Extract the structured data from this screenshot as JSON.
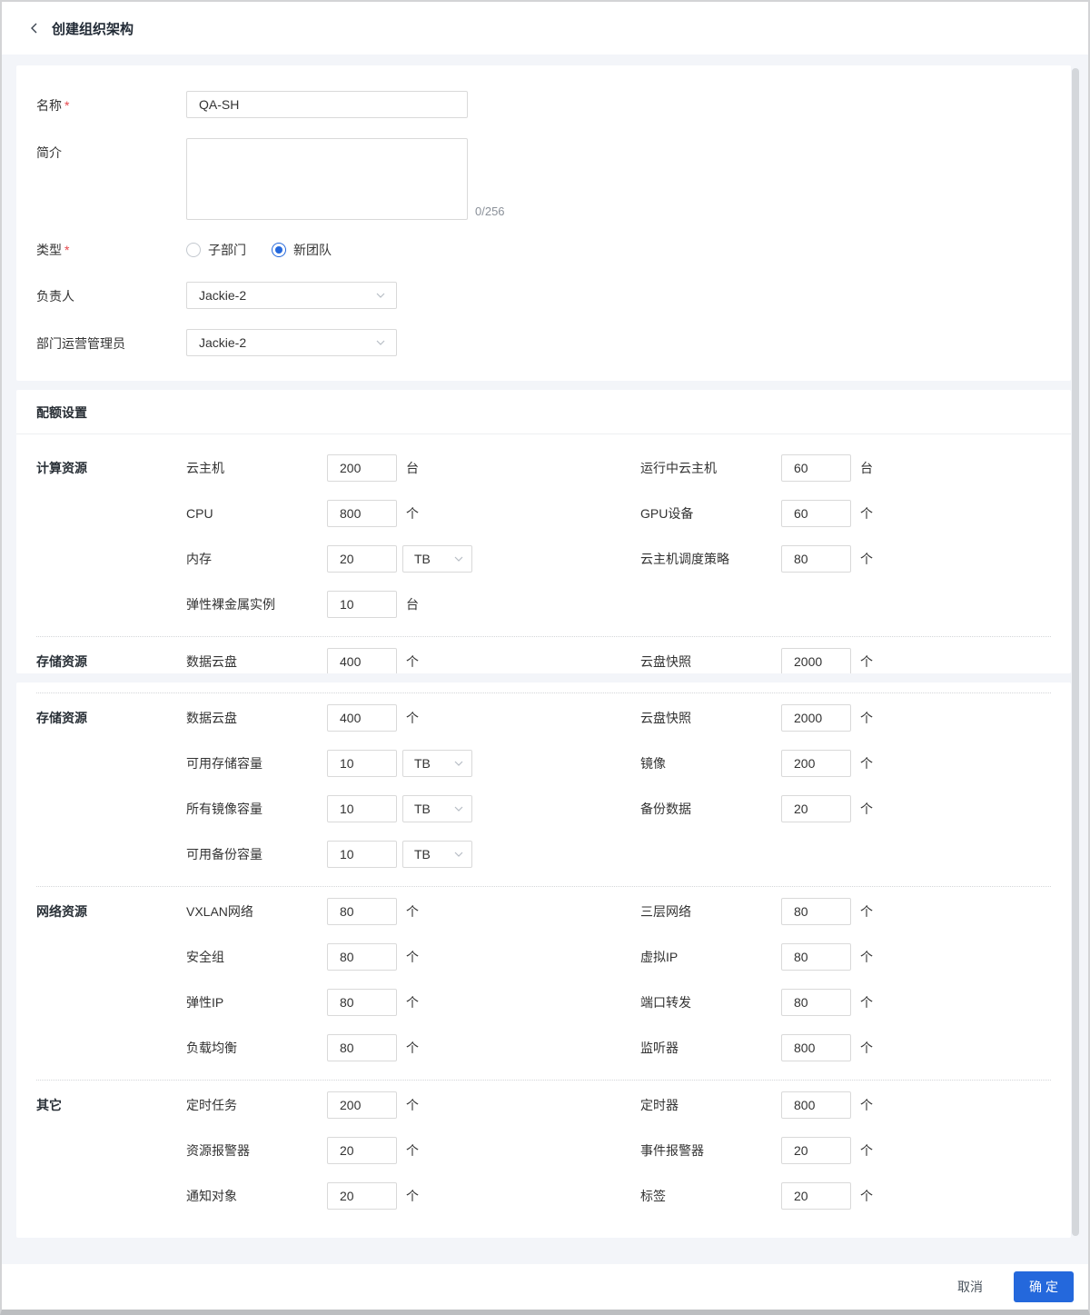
{
  "header": {
    "title": "创建组织架构"
  },
  "marks": {
    "required": "*"
  },
  "basic": {
    "name_label": "名称",
    "name_value": "QA-SH",
    "intro_label": "简介",
    "intro_value": "",
    "intro_counter": "0/256",
    "type_label": "类型",
    "type_options": [
      {
        "label": "子部门",
        "selected": false
      },
      {
        "label": "新团队",
        "selected": true
      }
    ],
    "owner_label": "负责人",
    "owner_value": "Jackie-2",
    "admin_label": "部门运营管理员",
    "admin_value": "Jackie-2"
  },
  "quota": {
    "title": "配额设置",
    "panel1_groups": [
      {
        "category": "计算资源",
        "rows": [
          [
            {
              "label": "云主机",
              "value": "200",
              "unit": "台"
            },
            {
              "label": "运行中云主机",
              "value": "60",
              "unit": "台"
            }
          ],
          [
            {
              "label": "CPU",
              "value": "800",
              "unit": "个"
            },
            {
              "label": "GPU设备",
              "value": "60",
              "unit": "个"
            }
          ],
          [
            {
              "label": "内存",
              "value": "20",
              "unit_select": "TB"
            },
            {
              "label": "云主机调度策略",
              "value": "80",
              "unit": "个"
            }
          ],
          [
            {
              "label": "弹性裸金属实例",
              "value": "10",
              "unit": "台"
            }
          ]
        ]
      },
      {
        "category": "存储资源",
        "rows": [
          [
            {
              "label": "数据云盘",
              "value": "400",
              "unit": "个"
            },
            {
              "label": "云盘快照",
              "value": "2000",
              "unit": "个"
            }
          ]
        ]
      }
    ],
    "panel2_groups": [
      {
        "category": "存储资源",
        "rows": [
          [
            {
              "label": "数据云盘",
              "value": "400",
              "unit": "个"
            },
            {
              "label": "云盘快照",
              "value": "2000",
              "unit": "个"
            }
          ],
          [
            {
              "label": "可用存储容量",
              "value": "10",
              "unit_select": "TB"
            },
            {
              "label": "镜像",
              "value": "200",
              "unit": "个"
            }
          ],
          [
            {
              "label": "所有镜像容量",
              "value": "10",
              "unit_select": "TB"
            },
            {
              "label": "备份数据",
              "value": "20",
              "unit": "个"
            }
          ],
          [
            {
              "label": "可用备份容量",
              "value": "10",
              "unit_select": "TB"
            }
          ]
        ]
      },
      {
        "category": "网络资源",
        "rows": [
          [
            {
              "label": "VXLAN网络",
              "value": "80",
              "unit": "个"
            },
            {
              "label": "三层网络",
              "value": "80",
              "unit": "个"
            }
          ],
          [
            {
              "label": "安全组",
              "value": "80",
              "unit": "个"
            },
            {
              "label": "虚拟IP",
              "value": "80",
              "unit": "个"
            }
          ],
          [
            {
              "label": "弹性IP",
              "value": "80",
              "unit": "个"
            },
            {
              "label": "端口转发",
              "value": "80",
              "unit": "个"
            }
          ],
          [
            {
              "label": "负载均衡",
              "value": "80",
              "unit": "个"
            },
            {
              "label": "监听器",
              "value": "800",
              "unit": "个"
            }
          ]
        ]
      },
      {
        "category": "其它",
        "rows": [
          [
            {
              "label": "定时任务",
              "value": "200",
              "unit": "个"
            },
            {
              "label": "定时器",
              "value": "800",
              "unit": "个"
            }
          ],
          [
            {
              "label": "资源报警器",
              "value": "20",
              "unit": "个"
            },
            {
              "label": "事件报警器",
              "value": "20",
              "unit": "个"
            }
          ],
          [
            {
              "label": "通知对象",
              "value": "20",
              "unit": "个"
            },
            {
              "label": "标签",
              "value": "20",
              "unit": "个"
            }
          ]
        ]
      }
    ]
  },
  "footer": {
    "cancel": "取消",
    "confirm": "确定"
  },
  "colors": {
    "accent": "#2468dc",
    "required": "#e5484d"
  }
}
